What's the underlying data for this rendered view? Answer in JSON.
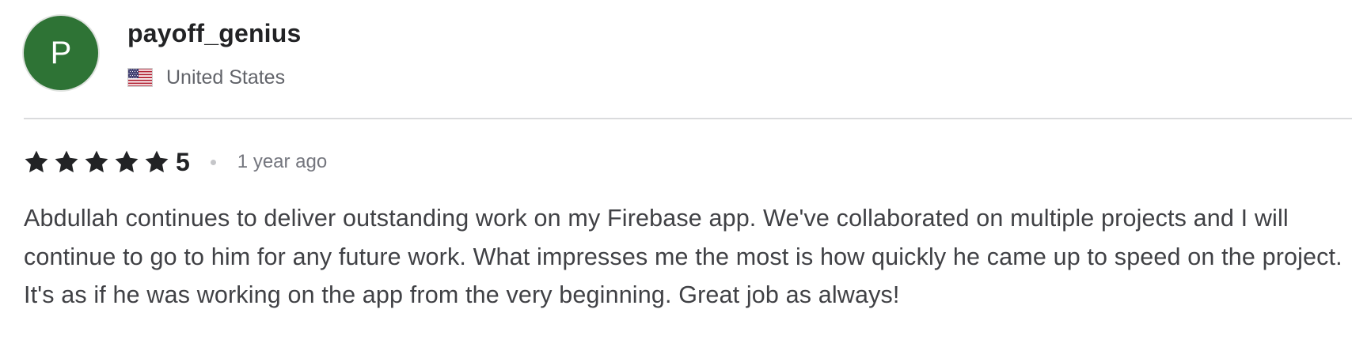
{
  "reviewer": {
    "avatar_letter": "P",
    "avatar_color": "#2e7335",
    "username": "payoff_genius",
    "country": "United States",
    "flag_icon": "us-flag-icon"
  },
  "rating": {
    "stars": 5,
    "max_stars": 5,
    "value": "5",
    "star_icon": "star-icon",
    "star_color": "#222325"
  },
  "meta": {
    "time_ago": "1 year ago"
  },
  "review": {
    "text": "Abdullah continues to deliver outstanding work on my Firebase app. We've collaborated on multiple projects and I will continue to go to him for any future work. What impresses me the most is how quickly he came up to speed on the project. It's as if he was working on the app from the very beginning. Great job as always!"
  }
}
